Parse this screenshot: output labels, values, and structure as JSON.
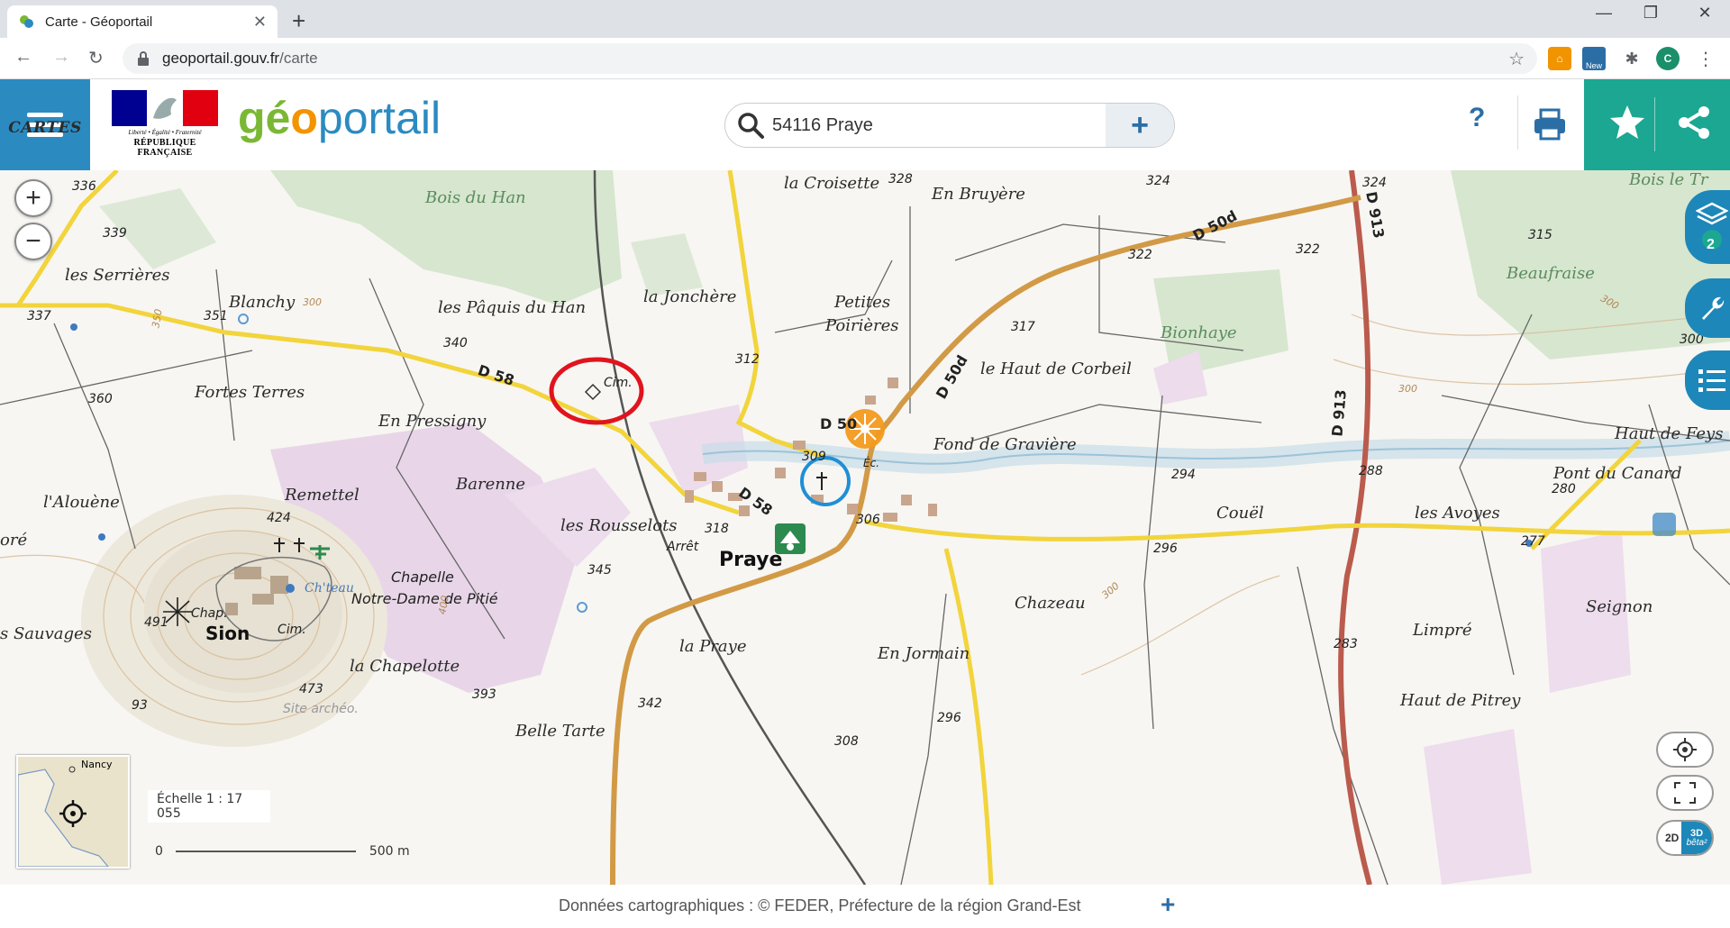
{
  "browser": {
    "tab_title": "Carte - Géoportail",
    "url_host": "geoportail.gouv.fr",
    "url_path": "/carte",
    "profile_initial": "C",
    "ext_badge": "New"
  },
  "header": {
    "cartes_label": "CARTES",
    "motto": "Liberté • Égalité • Fraternité",
    "republic": "RÉPUBLIQUE FRANÇAISE",
    "logo_geo": "gé",
    "logo_o": "o",
    "logo_portail": "portail",
    "search_value": "54116 Praye",
    "help": "?"
  },
  "map": {
    "layers_count": "2",
    "scale_label": "Échelle 1 : 17 055",
    "scale_start": "0",
    "scale_end": "500 m",
    "mode_2d": "2D",
    "mode_3d": "3D",
    "mode_beta": "bêta²",
    "minimap_label": "Nancy",
    "labels": {
      "bois_du_han": "Bois du Han",
      "la_croisette": "la Croisette",
      "en_bruyere": "En Bruyère",
      "bois_le_tr": "Bois le Tr",
      "les_serrieres": "les Serrières",
      "blanchy": "Blanchy",
      "les_paquis": "les Pâquis du Han",
      "la_jonchere": "la Jonchère",
      "petites": "Petites",
      "poirieres": "Poirières",
      "beaufraise": "Beaufraise",
      "bionhaye": "Bionhaye",
      "haut_corbeil": "le Haut de Corbeil",
      "fortes_terres": "Fortes Terres",
      "en_pressigny": "En Pressigny",
      "cim1": "Cim.",
      "fond_graviere": "Fond de Gravière",
      "haut_de_feys": "Haut de Feys",
      "pont_canard": "Pont du Canard",
      "barenne": "Barenne",
      "remettel": "Remettel",
      "alouene": "l'Alouène",
      "les_rousselots": "les Rousselots",
      "couel": "Couël",
      "les_avoyes": "les Avoyes",
      "ore": "oré",
      "chapelle1": "Chapelle",
      "chapelle2": "Notre-Dame de Pitié",
      "chateau": "Ch'teau",
      "chazeau": "Chazeau",
      "seignon": "Seignon",
      "sauvages": "s Sauvages",
      "chap": "Chap.",
      "sion": "Sion",
      "cim2": "Cim.",
      "la_chapelotte": "la Chapelotte",
      "la_praye": "la Praye",
      "en_jormain": "En Jormain",
      "limpre": "Limpré",
      "haut_pitrey": "Haut de Pitrey",
      "belle_tarte": "Belle Tarte",
      "site_archeo": "Site archéo.",
      "praye": "Praye",
      "arret": "Arrêt",
      "ec": "Éc."
    },
    "roads": {
      "d58a": "D 58",
      "d58b": "D 58",
      "d50": "D 50",
      "d50d_a": "D 50d",
      "d50d_b": "D 50d",
      "d913_a": "D 913",
      "d913_b": "D 913"
    },
    "altitudes": {
      "a336": "336",
      "a339": "339",
      "a337": "337",
      "a351": "351",
      "a340": "340",
      "a360": "360",
      "a328": "328",
      "a324a": "324",
      "a324b": "324",
      "a322a": "322",
      "a322b": "322",
      "a315": "315",
      "a317": "317",
      "a312": "312",
      "a309": "309",
      "a306": "306",
      "a318": "318",
      "a345": "345",
      "a424": "424",
      "a491": "491",
      "a473": "473",
      "a393": "393",
      "a93": "93",
      "a342": "342",
      "a296a": "296",
      "a296b": "296",
      "a294": "294",
      "a288": "288",
      "a280": "280",
      "a277": "277",
      "a283": "283",
      "a308": "308",
      "a300a": "300",
      "a300b": "300",
      "a300c": "300",
      "a350": "350",
      "a400": "400",
      "a300d": "300",
      "a300e": "300"
    }
  },
  "footer": {
    "text": "Données cartographiques : ©    FEDER,  Préfecture de la région Grand-Est",
    "plus": "+"
  },
  "colors": {
    "primary_blue": "#2b8bc1",
    "teal": "#1ca792",
    "red_circle": "#e0141e",
    "blue_circle": "#1f8fd6",
    "orange_marker": "#f39a1e"
  }
}
